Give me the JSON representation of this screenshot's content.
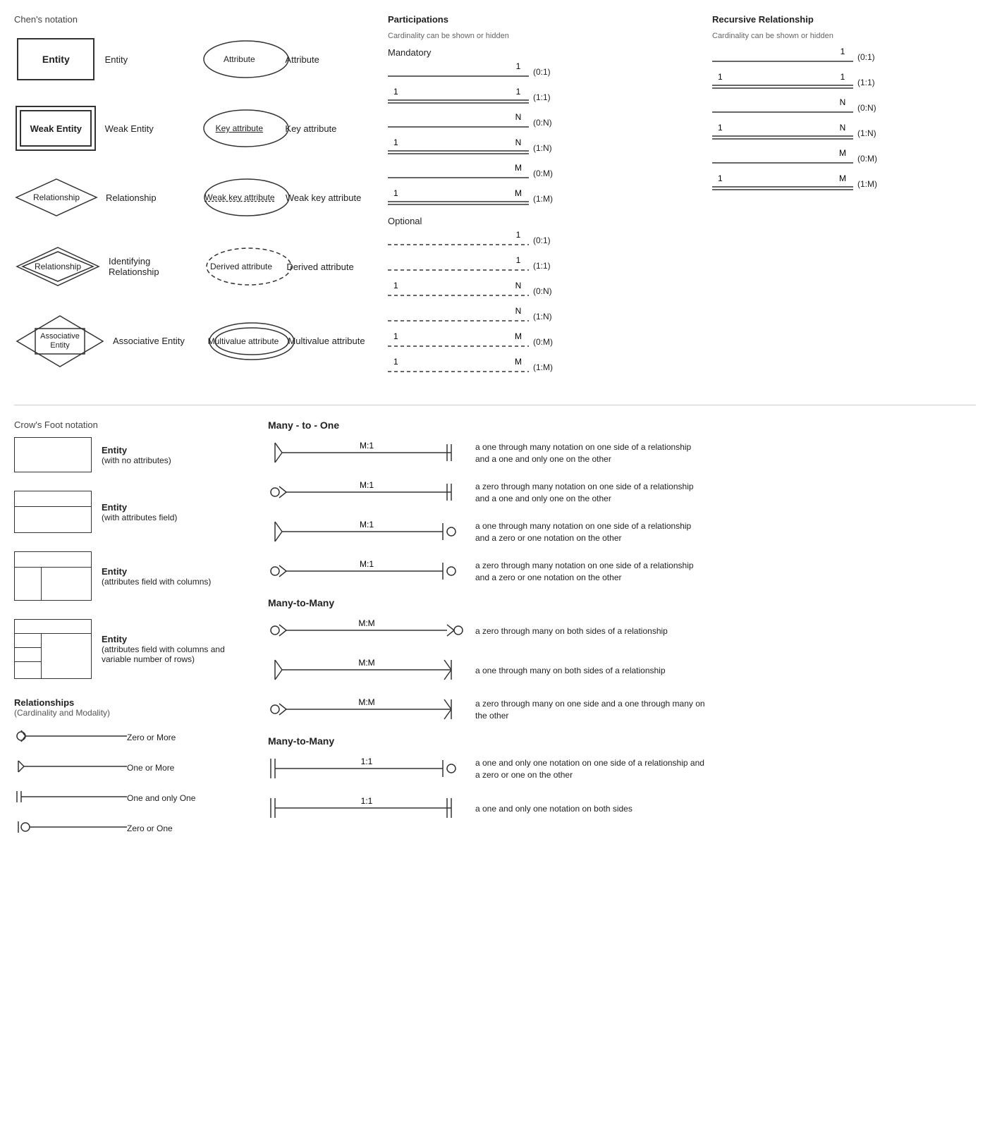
{
  "chens": {
    "section_title": "Chen's notation",
    "rows": [
      {
        "symbol_type": "entity",
        "symbol_label": "Entity",
        "label": "Entity"
      },
      {
        "symbol_type": "weak_entity",
        "symbol_label": "Weak Entity",
        "label": "Weak Entity"
      },
      {
        "symbol_type": "relationship",
        "symbol_label": "Relationship",
        "label": "Relationship"
      },
      {
        "symbol_type": "identifying_relationship",
        "symbol_label": "Relationship",
        "label": "Identifying Relationship"
      },
      {
        "symbol_type": "associative_entity",
        "symbol_label": "Associative Entity",
        "label": "Associative Entity"
      }
    ],
    "attributes": [
      {
        "symbol_type": "attribute",
        "symbol_label": "Attribute",
        "label": "Attribute"
      },
      {
        "symbol_type": "key_attribute",
        "symbol_label": "Key attribute",
        "label": "Key attribute"
      },
      {
        "symbol_type": "weak_key_attribute",
        "symbol_label": "Weak key attribute",
        "label": "Weak key attribute"
      },
      {
        "symbol_type": "derived_attribute",
        "symbol_label": "Derived attribute",
        "label": "Derived attribute"
      },
      {
        "symbol_type": "multivalue_attribute",
        "symbol_label": "Multivalue attribute",
        "label": "Multivalue attribute"
      }
    ]
  },
  "participations": {
    "section_title": "Participations",
    "section_subtitle": "Cardinality can be shown or hidden",
    "mandatory_title": "Mandatory",
    "mandatory_rows": [
      {
        "left_num": "",
        "right_num": "1",
        "cardinality": "(0:1)"
      },
      {
        "left_num": "1",
        "right_num": "1",
        "cardinality": "(1:1)"
      },
      {
        "left_num": "",
        "right_num": "N",
        "cardinality": "(0:N)"
      },
      {
        "left_num": "1",
        "right_num": "N",
        "cardinality": "(1:N)"
      },
      {
        "left_num": "",
        "right_num": "M",
        "cardinality": "(0:M)"
      },
      {
        "left_num": "1",
        "right_num": "M",
        "cardinality": "(1:M)"
      }
    ],
    "optional_title": "Optional",
    "optional_rows": [
      {
        "left_num": "",
        "right_num": "1",
        "cardinality": "(0:1)"
      },
      {
        "left_num": "",
        "right_num": "1",
        "cardinality": "(1:1)"
      },
      {
        "left_num": "1",
        "right_num": "N",
        "cardinality": "(0:N)"
      },
      {
        "left_num": "",
        "right_num": "N",
        "cardinality": "(1:N)"
      },
      {
        "left_num": "1",
        "right_num": "M",
        "cardinality": "(0:M)"
      },
      {
        "left_num": "1",
        "right_num": "M",
        "cardinality": "(1:M)"
      }
    ]
  },
  "recursive": {
    "section_title": "Recursive Relationship",
    "section_subtitle": "Cardinality can be shown or hidden",
    "rows": [
      {
        "left_num": "",
        "right_num": "1",
        "cardinality": "(0:1)"
      },
      {
        "left_num": "1",
        "right_num": "1",
        "cardinality": "(1:1)"
      },
      {
        "left_num": "",
        "right_num": "N",
        "cardinality": "(0:N)"
      },
      {
        "left_num": "1",
        "right_num": "N",
        "cardinality": "(1:N)"
      },
      {
        "left_num": "",
        "right_num": "M",
        "cardinality": "(0:M)"
      },
      {
        "left_num": "1",
        "right_num": "M",
        "cardinality": "(1:M)"
      }
    ]
  },
  "crows": {
    "section_title": "Crow's Foot notation",
    "entities": [
      {
        "type": "simple",
        "label": "Entity",
        "sublabel": "(with no attributes)"
      },
      {
        "type": "with_attr",
        "label": "Entity",
        "sublabel": "(with attributes field)"
      },
      {
        "type": "with_cols",
        "label": "Entity",
        "sublabel": "(attributes field with columns)"
      },
      {
        "type": "with_rows",
        "label": "Entity",
        "sublabel": "(attributes field with columns and variable number of rows)"
      }
    ],
    "relationships_title": "Relationships",
    "relationships_subtitle": "(Cardinality and Modality)",
    "relationships": [
      {
        "type": "zero_or_more",
        "label": "Zero or More"
      },
      {
        "type": "one_or_more",
        "label": "One or More"
      },
      {
        "type": "one_and_only_one",
        "label": "One and only One"
      },
      {
        "type": "zero_or_one",
        "label": "Zero or One"
      }
    ],
    "many_to_one_title": "Many - to - One",
    "many_to_one_rows": [
      {
        "label": "M:1",
        "left": "one_or_more",
        "right": "one_only",
        "desc": "a one through many notation on one side of a relationship and a one and only one on the other"
      },
      {
        "label": "M:1",
        "left": "zero_or_more",
        "right": "one_only",
        "desc": "a zero through many notation on one side of a relationship and a one and only one on the other"
      },
      {
        "label": "M:1",
        "left": "one_or_more",
        "right": "zero_or_one",
        "desc": "a one through many notation on one side of a relationship and a zero or one notation on the other"
      },
      {
        "label": "M:1",
        "left": "zero_or_more",
        "right": "zero_or_one",
        "desc": "a zero through many notation on one side of a relationship and a zero or one notation on the other"
      }
    ],
    "many_to_many_title": "Many-to-Many",
    "many_to_many_rows": [
      {
        "label": "M:M",
        "left": "zero_or_more",
        "right": "zero_or_more",
        "desc": "a zero through many on both sides of a relationship"
      },
      {
        "label": "M:M",
        "left": "one_or_more",
        "right": "one_or_more",
        "desc": "a one through many on both sides of a relationship"
      },
      {
        "label": "M:M",
        "left": "zero_or_more",
        "right": "one_or_more_r",
        "desc": "a zero through many on one side and a one through many on the other"
      }
    ],
    "many_to_many2_title": "Many-to-Many",
    "one_to_one_rows": [
      {
        "label": "1:1",
        "left": "one_only",
        "right": "zero_or_one",
        "desc": "a one and only one notation on one side of a relationship and a zero or one on the other"
      },
      {
        "label": "1:1",
        "left": "one_only",
        "right": "one_only",
        "desc": "a one and only one notation on both sides"
      }
    ]
  }
}
